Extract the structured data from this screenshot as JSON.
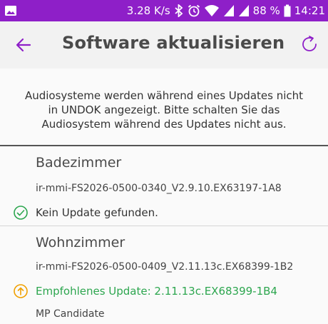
{
  "status_bar": {
    "network_speed": "3.28 K/s",
    "battery": "88 %",
    "time": "14:21",
    "icons": [
      "image-icon",
      "bluetooth-icon",
      "alarm-icon",
      "wifi-icon",
      "signal-icon",
      "battery-icon"
    ]
  },
  "toolbar": {
    "title": "Software aktualisieren",
    "back_icon": "arrow-left-icon",
    "refresh_icon": "refresh-icon"
  },
  "notice": "Audiosysteme werden während eines Updates nicht in UNDOK angezeigt. Bitte schalten Sie das Audiosystem während des Updates nicht aus.",
  "devices": [
    {
      "name": "Badezimmer",
      "firmware": "ir-mmi-FS2026-0500-0340_V2.9.10.EX63197-1A8",
      "status_icon": "check-circle-icon",
      "status": "Kein Update gefunden."
    },
    {
      "name": "Wohnzimmer",
      "firmware": "ir-mmi-FS2026-0500-0409_V2.11.13c.EX68399-1B2",
      "status_icon": "arrow-up-circle-icon",
      "status": "Empfohlenes Update: 2.11.13c.EX68399-1B4",
      "note": "MP Candidate"
    }
  ],
  "colors": {
    "status_bar": "#8e1fc8",
    "accent": "#8e1fc8",
    "ok_green": "#2da64f",
    "update_orange": "#f0a000"
  }
}
